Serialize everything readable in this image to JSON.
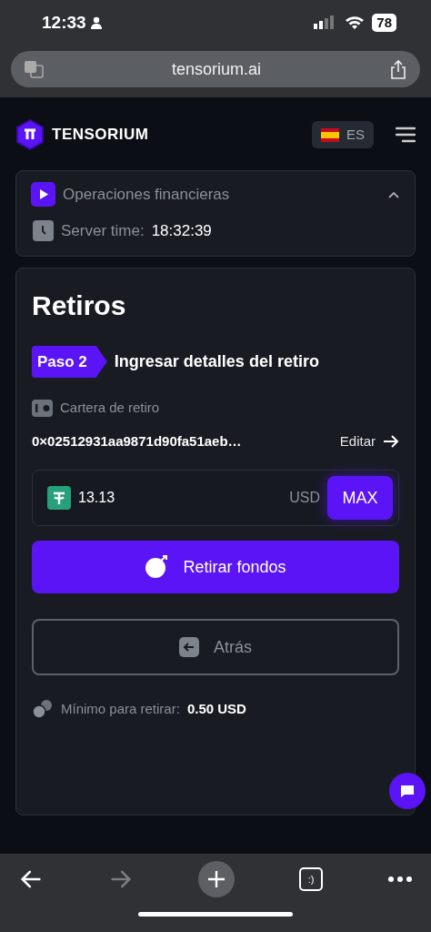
{
  "status_bar": {
    "time": "12:33",
    "battery": "78"
  },
  "browser": {
    "url": "tensorium.ai",
    "tab_count": ":)",
    "nav": [
      {
        "kind": "back",
        "disabled": false
      },
      {
        "kind": "forward",
        "disabled": true
      }
    ]
  },
  "header": {
    "brand": "TENSORIUM",
    "language": "ES"
  },
  "panel": {
    "title": "Operaciones financieras",
    "expanded": true,
    "server_time_label": "Server time:",
    "server_time": "18:32:39"
  },
  "card": {
    "title": "Retiros",
    "step_badge": "Paso 2",
    "step_title": "Ingresar detalles del retiro",
    "wallet_label": "Cartera de retiro",
    "wallet_address": "0×02512931aa9871d90fa51aeb…",
    "edit_link": "Editar",
    "amount": "13.13",
    "currency": "USD",
    "max_button": "MAX",
    "withdraw_button": "Retirar fondos",
    "back_button": "Atrás",
    "minimum_label": "Mínimo para retirar:",
    "minimum_value": "0.50 USD"
  }
}
